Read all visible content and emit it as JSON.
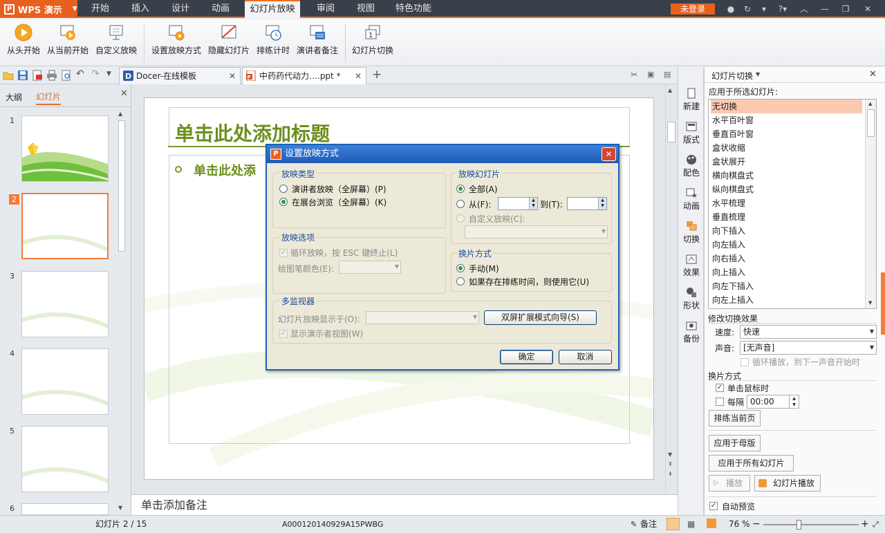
{
  "app": {
    "name": "WPS 演示",
    "login": "未登录"
  },
  "menu": [
    "开始",
    "插入",
    "设计",
    "动画",
    "幻灯片放映",
    "审阅",
    "视图",
    "特色功能"
  ],
  "ribbon": [
    "从头开始",
    "从当前开始",
    "自定义放映",
    "设置放映方式",
    "隐藏幻灯片",
    "排练计时",
    "演讲者备注",
    "幻灯片切换"
  ],
  "tabs": [
    {
      "label": "Docer-在线模板",
      "active": false
    },
    {
      "label": "中药药代动力….ppt *",
      "active": true
    }
  ],
  "left_panel": {
    "tabs": [
      "大纲",
      "幻灯片"
    ],
    "active": "幻灯片",
    "thumbs": [
      "1",
      "2",
      "3",
      "4",
      "5",
      "6"
    ],
    "selected": "2"
  },
  "slide": {
    "title": "单击此处添加标题",
    "bullet": "单击此处添"
  },
  "notes": "单击添加备注",
  "vtools": [
    "新建",
    "版式",
    "配色",
    "动画",
    "切换",
    "效果",
    "形状",
    "备份"
  ],
  "pane": {
    "title": "幻灯片切换",
    "apply_label": "应用于所选幻灯片:",
    "transitions": [
      "无切换",
      "水平百叶窗",
      "垂直百叶窗",
      "盒状收缩",
      "盒状展开",
      "横向棋盘式",
      "纵向棋盘式",
      "水平梳理",
      "垂直梳理",
      "向下插入",
      "向左插入",
      "向右插入",
      "向上插入",
      "向左下插入",
      "向左上插入"
    ],
    "selected_transition": "无切换",
    "modify_label": "修改切换效果",
    "speed_label": "速度:",
    "speed_value": "快速",
    "sound_label": "声音:",
    "sound_value": "[无声音]",
    "loop_label": "循环播放，到下一声音开始时",
    "advance_label": "换片方式",
    "on_click_label": "单击鼠标时",
    "every_label": "每隔",
    "every_value": "00:00",
    "rehearse_button": "排练当前页",
    "apply_master_button": "应用于母版",
    "apply_all_button": "应用于所有幻灯片",
    "play_button": "播放",
    "slideshow_button": "幻灯片播放",
    "autopreview_label": "自动预览"
  },
  "dialog": {
    "title": "设置放映方式",
    "type_group": "放映类型",
    "type_options": [
      "演讲者放映（全屏幕）(P)",
      "在展台浏览（全屏幕）(K)"
    ],
    "type_selected": 1,
    "options_group": "放映选项",
    "loop_label": "循环放映，按 ESC 键终止(L)",
    "pen_label": "绘图笔颜色(E):",
    "slides_group": "放映幻灯片",
    "all_label": "全部(A)",
    "from_label": "从(F):",
    "to_label": "到(T):",
    "custom_label": "自定义放映(C):",
    "advance_group": "换片方式",
    "manual_label": "手动(M)",
    "timing_label": "如果存在排练时间，则使用它(U)",
    "monitor_group": "多监视器",
    "display_label": "幻灯片放映显示于(O):",
    "dual_button": "双屏扩展模式向导(S)",
    "presenter_label": "显示演示者视图(W)",
    "ok": "确定",
    "cancel": "取消"
  },
  "status": {
    "slide": "幻灯片 2 / 15",
    "template": "A000120140929A15PWBG",
    "notes_btn": "备注",
    "zoom": "76 %"
  }
}
